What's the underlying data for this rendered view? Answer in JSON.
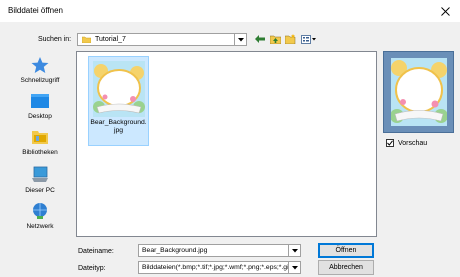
{
  "window": {
    "title": "Bilddatei öffnen",
    "close_icon": "close-icon"
  },
  "toolbar": {
    "lookin_label": "Suchen in:",
    "lookin_value": "Tutorial_7",
    "icons": [
      "back-arrow-icon",
      "up-folder-icon",
      "new-folder-icon",
      "view-menu-icon"
    ]
  },
  "places": [
    {
      "label": "Schnellzugriff",
      "icon": "star-icon"
    },
    {
      "label": "Desktop",
      "icon": "desktop-icon"
    },
    {
      "label": "Bibliotheken",
      "icon": "libraries-icon"
    },
    {
      "label": "Dieser PC",
      "icon": "computer-icon"
    },
    {
      "label": "Netzwerk",
      "icon": "network-icon"
    }
  ],
  "files": [
    {
      "name": "Bear_Background.jpg",
      "selected": true
    }
  ],
  "preview": {
    "checkbox_label": "Vorschau",
    "checked": true
  },
  "bottom": {
    "filename_label": "Dateiname:",
    "filename_value": "Bear_Background.jpg",
    "filetype_label": "Dateityp:",
    "filetype_value": "Bilddateien(*.bmp;*.tif;*.jpg;*.wmf;*.png;*.eps;*.gif)",
    "open_button": "Öffnen",
    "cancel_button": "Abbrechen"
  },
  "colors": {
    "selection_bg": "#cce8ff",
    "selection_border": "#99d1ff",
    "preview_bg": "#6a8fb8",
    "default_button_border": "#0078d7"
  }
}
